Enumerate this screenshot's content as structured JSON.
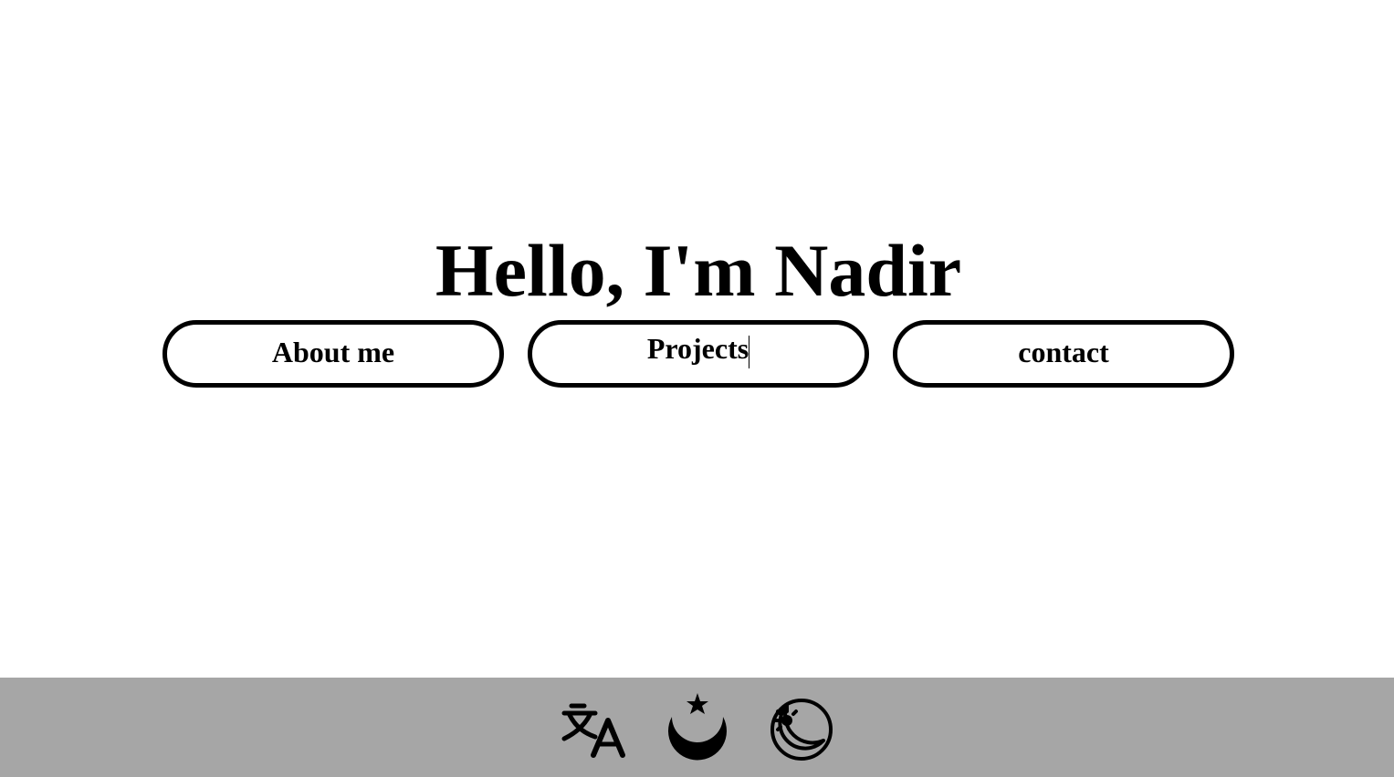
{
  "hero": {
    "title": "Hello, I'm Nadir"
  },
  "nav": {
    "about_label": "About me",
    "projects_label": "Projects",
    "contact_label": "contact"
  },
  "footer": {
    "background_color": "#a6a6a6",
    "icons": [
      "translate-icon",
      "dark-mode-moon-star-icon",
      "auto-theme-sun-moon-icon"
    ]
  }
}
